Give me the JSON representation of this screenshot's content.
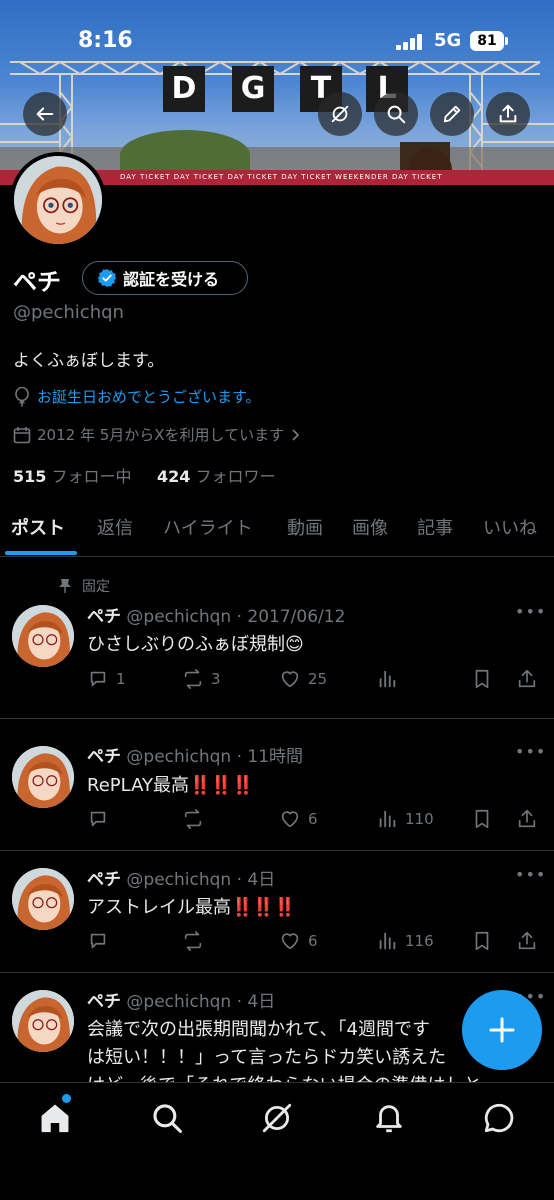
{
  "status_bar": {
    "time": "8:16",
    "network": "5G",
    "battery": "81"
  },
  "banner": {
    "sign": [
      "D",
      "G",
      "T",
      "L"
    ],
    "ticket_text": "DAY TICKET   DAY TICKET   DAY TICKET   DAY TICKET   WEEKENDER   DAY TICKET"
  },
  "icons": {
    "back": "back-arrow-icon",
    "grok": "grok-icon",
    "search": "search-icon",
    "edit": "pencil-icon",
    "share": "share-icon"
  },
  "profile": {
    "name": "ペチ",
    "verify_label": "認証を受ける",
    "handle": "@pechichqn",
    "bio": "よくふぁぼします。",
    "birthday": "お誕生日おめでとうございます。",
    "joined": "2012 年 5月からXを利用しています",
    "following_count": "515",
    "following_label": "フォロー中",
    "followers_count": "424",
    "followers_label": "フォロワー"
  },
  "tabs": [
    "ポスト",
    "返信",
    "ハイライト",
    "動画",
    "画像",
    "記事",
    "いいね"
  ],
  "pinned_label": "固定",
  "posts": [
    {
      "name": "ペチ",
      "meta": "@pechichqn · 2017/06/12",
      "text": "ひさしぶりのふぁぼ規制😊",
      "replies": "1",
      "reposts": "3",
      "likes": "25",
      "views": ""
    },
    {
      "name": "ペチ",
      "meta": "@pechichqn · 11時間",
      "text": "RePLAY最高",
      "replies": "",
      "reposts": "",
      "likes": "6",
      "views": "110"
    },
    {
      "name": "ペチ",
      "meta": "@pechichqn · 4日",
      "text": "アストレイル最高",
      "replies": "",
      "reposts": "",
      "likes": "6",
      "views": "116"
    },
    {
      "name": "ペチ",
      "meta": "@pechichqn · 4日",
      "text_lines": [
        "会議で次の出張期間聞かれて、「4週間です",
        "は短い！！！」って言ったらドカ笑い誘えた",
        "けど、後で「それで終わらない場合の準備はしと"
      ]
    }
  ],
  "exclaim": "‼️‼️‼️",
  "colors": {
    "accent": "#1d9bf0",
    "muted": "#71767b",
    "text": "#e7e9ea",
    "divider": "#2f3336"
  }
}
